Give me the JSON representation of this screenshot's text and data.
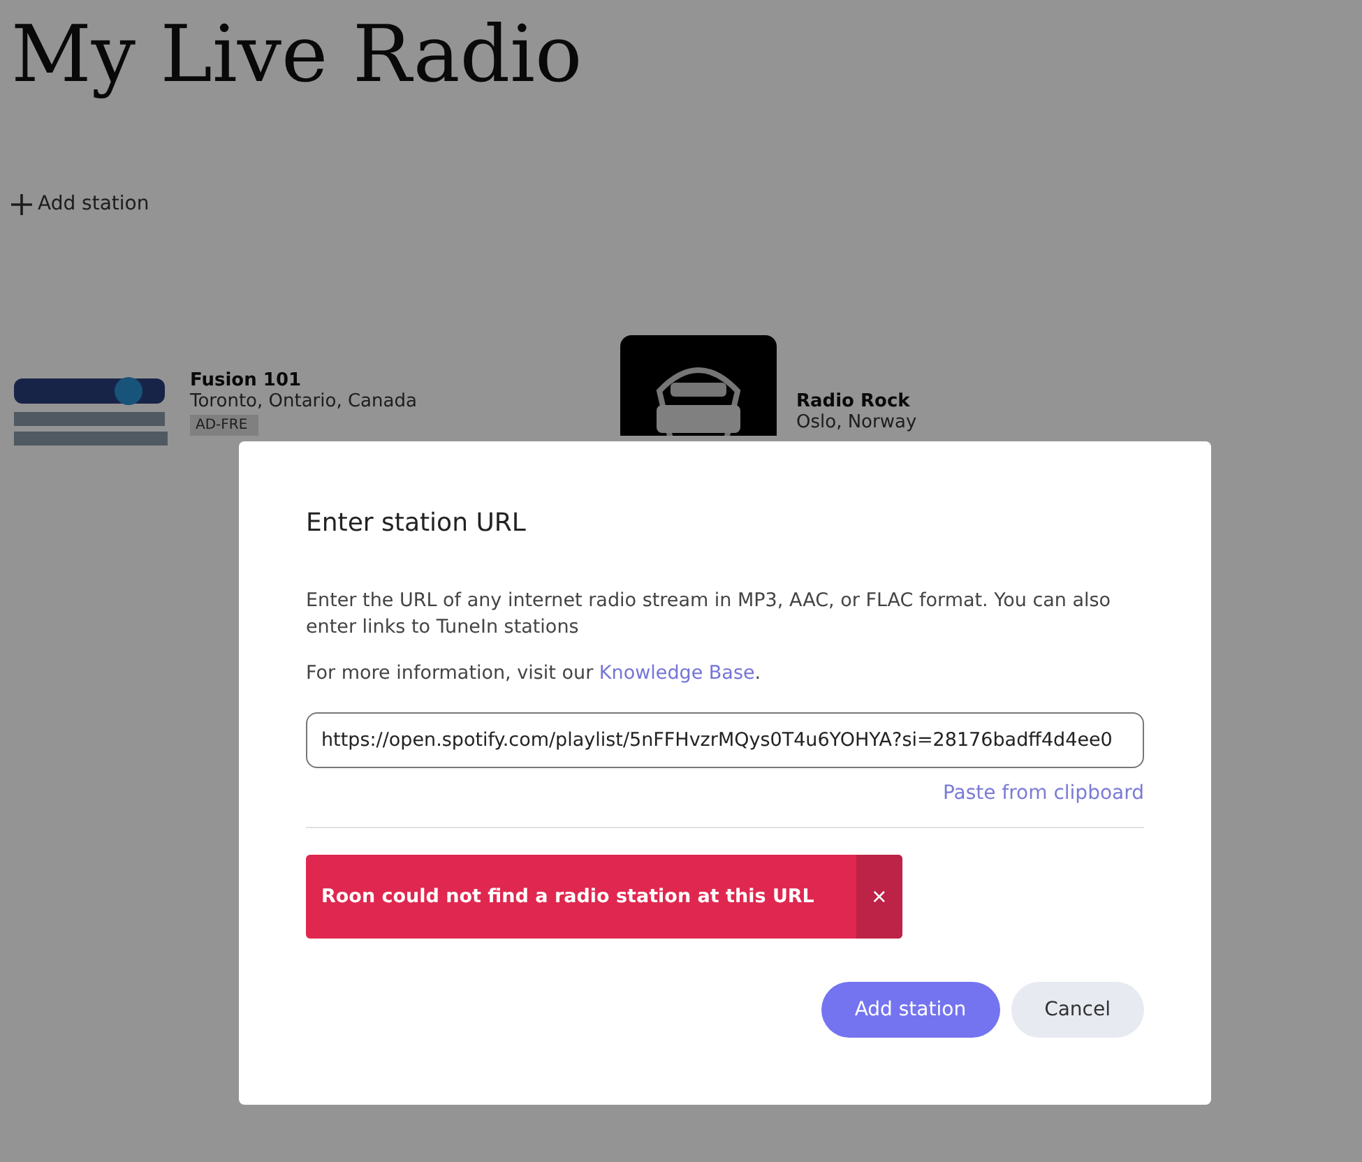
{
  "page": {
    "title": "My Live Radio",
    "add_station": "Add station"
  },
  "stations": [
    {
      "name": "Fusion 101",
      "location": "Toronto, Ontario, Canada",
      "badge": "AD-FRE",
      "kind": "picture"
    },
    {
      "name": "Radio Rock",
      "location": "Oslo, Norway",
      "kind": "picture"
    }
  ],
  "dialog": {
    "title": "Enter station URL",
    "description": "Enter the URL of any internet radio stream in MP3, AAC, or FLAC format. You can also enter links to TuneIn stations",
    "info_prefix": "For more information, visit our ",
    "info_link": "Knowledge Base",
    "info_suffix": ".",
    "url_value": "https://open.spotify.com/playlist/5nFFHvzrMQys0T4u6YOHYA?si=28176badff4d4ee0",
    "paste": "Paste from clipboard",
    "error": {
      "message": "Roon could not find a radio station at this URL",
      "close": "×"
    },
    "buttons": [
      {
        "label": "Add station",
        "kind": "primary"
      },
      {
        "label": "Cancel",
        "kind": "secondary"
      }
    ]
  }
}
